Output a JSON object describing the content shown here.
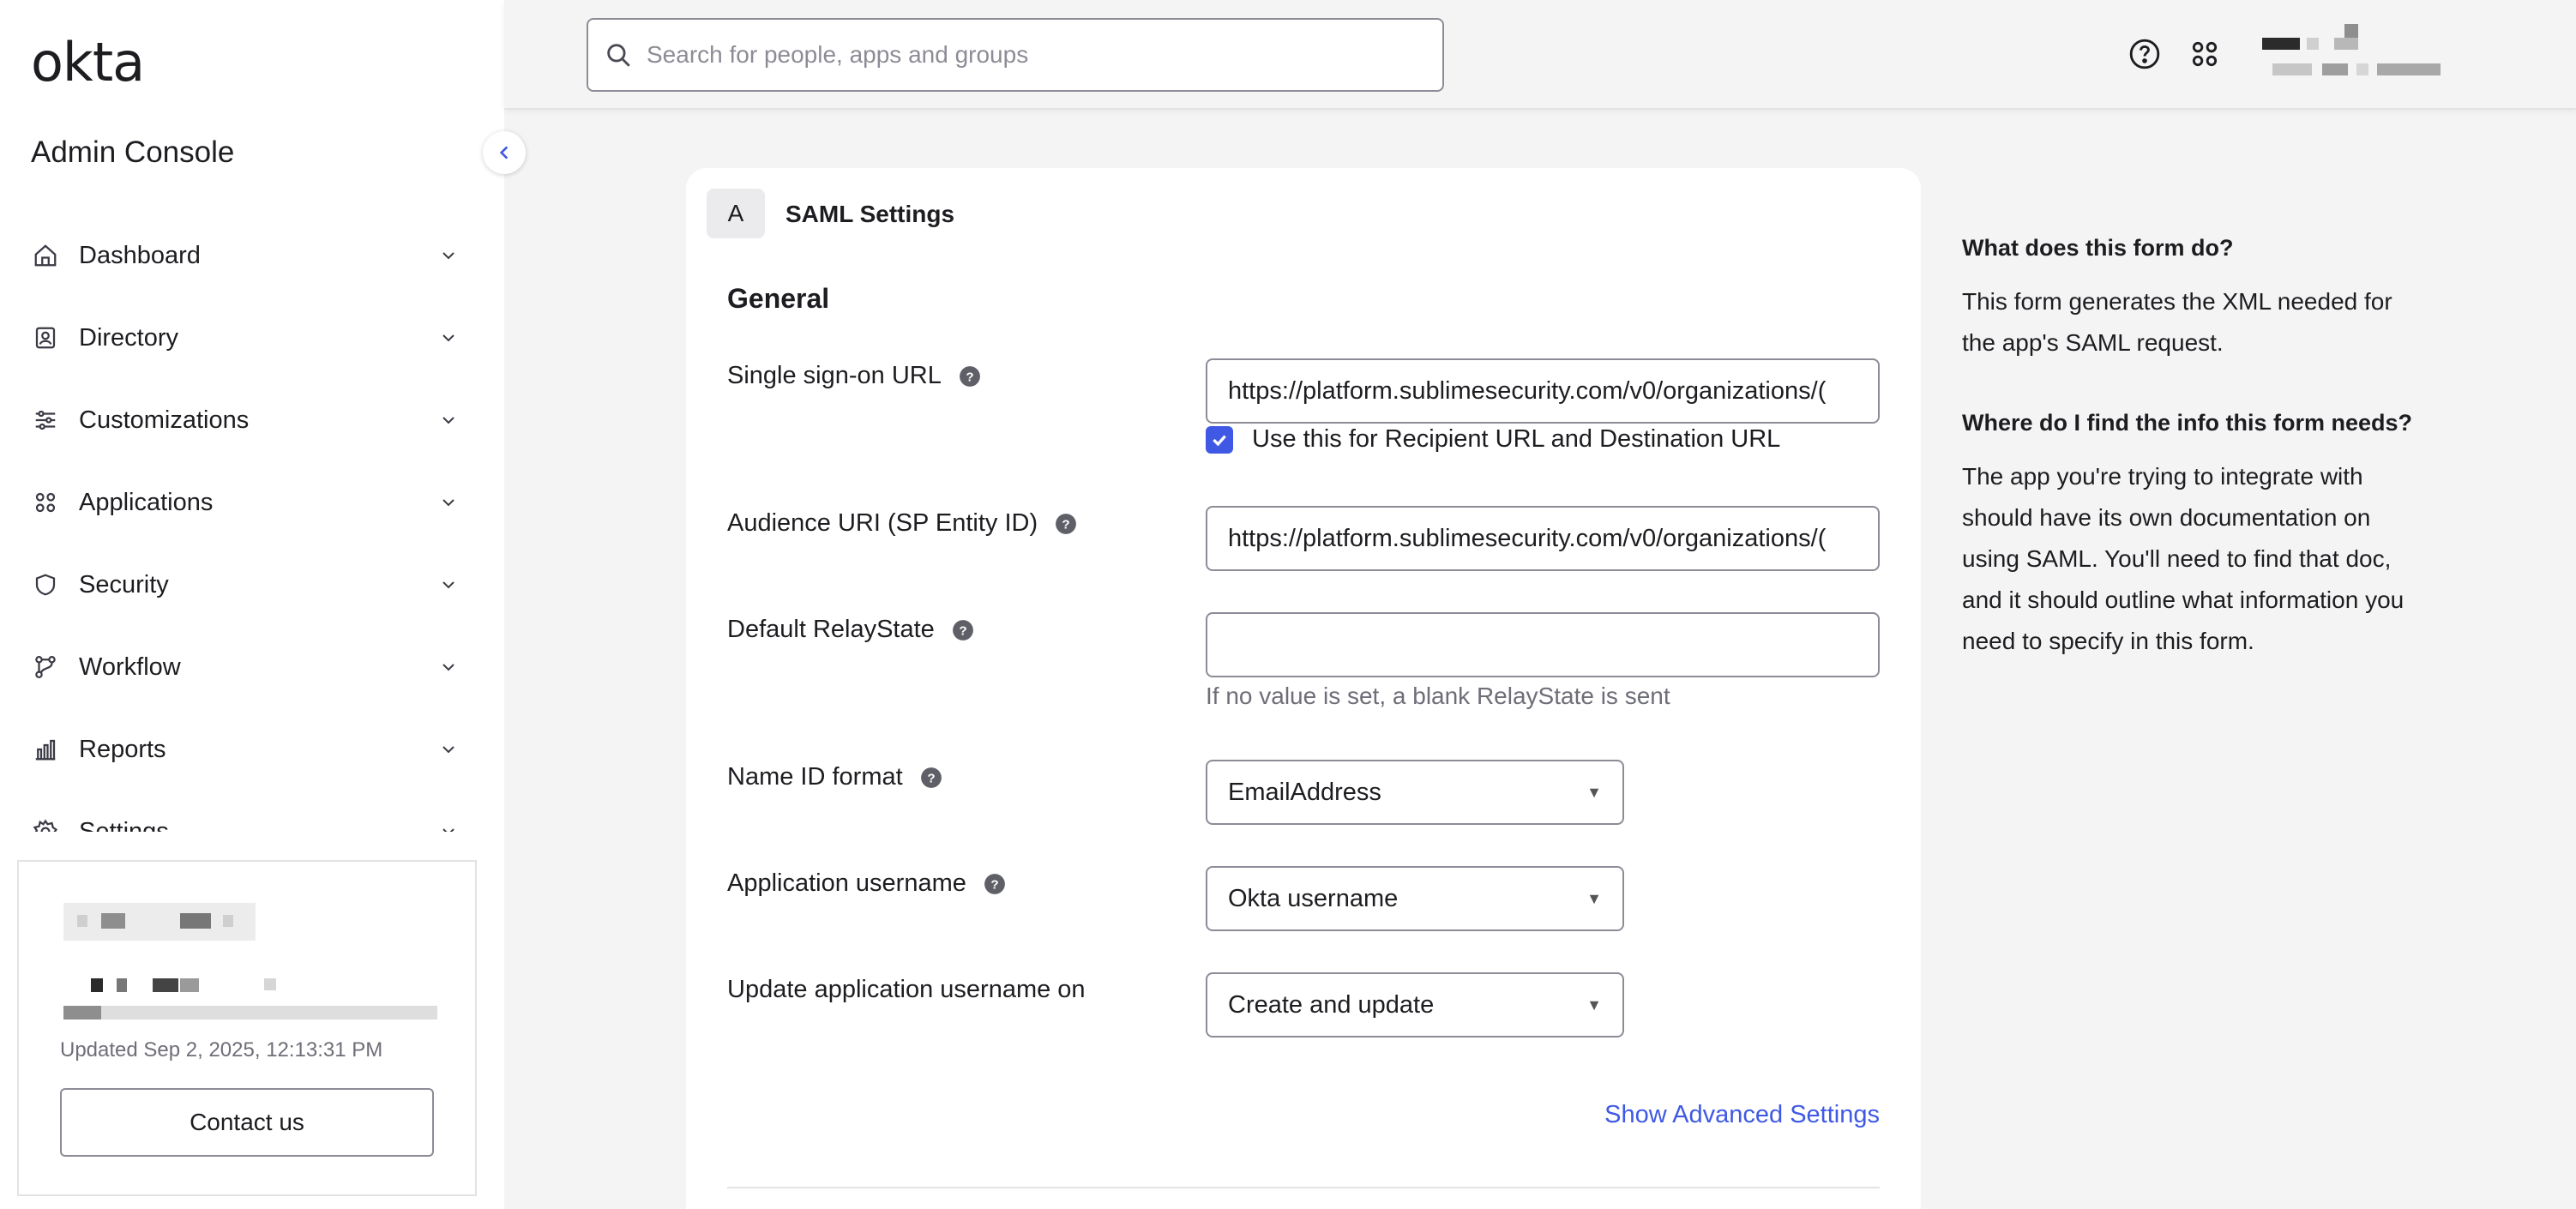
{
  "sidebar": {
    "logo": "okta",
    "title": "Admin Console",
    "items": [
      {
        "label": "Dashboard"
      },
      {
        "label": "Directory"
      },
      {
        "label": "Customizations"
      },
      {
        "label": "Applications"
      },
      {
        "label": "Security"
      },
      {
        "label": "Workflow"
      },
      {
        "label": "Reports"
      },
      {
        "label": "Settings"
      }
    ],
    "license": {
      "updated": "Updated Sep 2, 2025, 12:13:31 PM",
      "contact_label": "Contact us"
    }
  },
  "header": {
    "search_placeholder": "Search for people, apps and groups"
  },
  "form": {
    "step_letter": "A",
    "step_title": "SAML Settings",
    "section_title": "General",
    "sso_url": {
      "label": "Single sign-on URL",
      "value": "https://platform.sublimesecurity.com/v0/organizations/("
    },
    "recipient_checkbox": {
      "label": "Use this for Recipient URL and Destination URL",
      "checked": true
    },
    "audience_uri": {
      "label": "Audience URI (SP Entity ID)",
      "value": "https://platform.sublimesecurity.com/v0/organizations/("
    },
    "relay_state": {
      "label": "Default RelayState",
      "value": "",
      "hint": "If no value is set, a blank RelayState is sent"
    },
    "name_id_format": {
      "label": "Name ID format",
      "value": "EmailAddress"
    },
    "app_username": {
      "label": "Application username",
      "value": "Okta username"
    },
    "update_username_on": {
      "label": "Update application username on",
      "value": "Create and update"
    },
    "advanced_link": "Show Advanced Settings"
  },
  "aside": {
    "q1": "What does this form do?",
    "a1": "This form generates the XML needed for the app's SAML request.",
    "q2": "Where do I find the info this form needs?",
    "a2": "The app you're trying to integrate with should have its own documentation on using SAML. You'll need to find that doc, and it should outline what information you need to specify in this form."
  },
  "colors": {
    "accent": "#3f59e4",
    "page_bg": "#f4f4f4",
    "border": "#8c8c96"
  }
}
